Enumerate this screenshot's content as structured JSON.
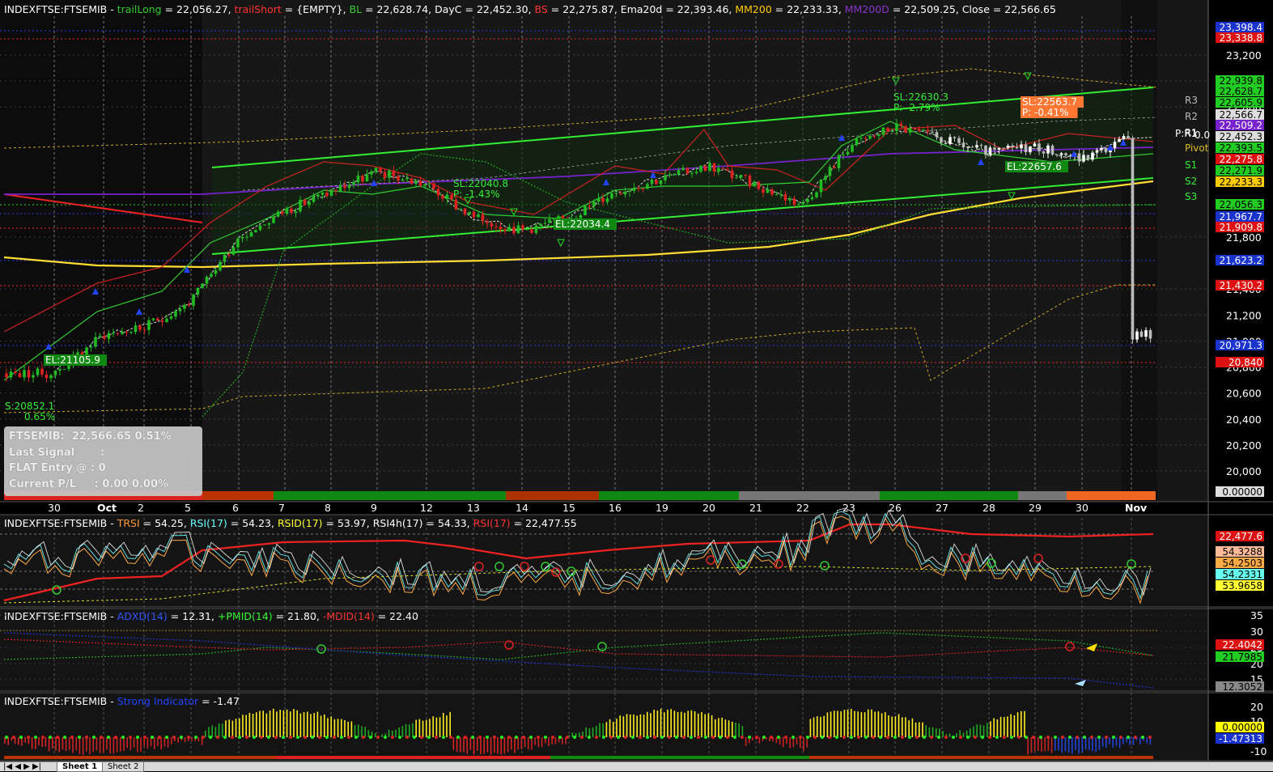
{
  "panels": {
    "price": {
      "header": [
        {
          "t": "INDEXFTSE:FTSEMIB - ",
          "c": "#ffffff"
        },
        {
          "t": "trailLong",
          "c": "#33cc33"
        },
        {
          "t": " = 22,056.27, ",
          "c": "#ffffff"
        },
        {
          "t": "trailShort",
          "c": "#ff3333"
        },
        {
          "t": " = {EMPTY}, ",
          "c": "#ffffff"
        },
        {
          "t": "BL",
          "c": "#33cc33"
        },
        {
          "t": " = 22,628.74, DayC = 22,452.30, ",
          "c": "#ffffff"
        },
        {
          "t": "BS",
          "c": "#ff3333"
        },
        {
          "t": " = 22,275.87, Ema20d = 22,393.46, ",
          "c": "#ffffff"
        },
        {
          "t": "MM200",
          "c": "#ffcc00"
        },
        {
          "t": " = 22,233.33, ",
          "c": "#ffffff"
        },
        {
          "t": "MM200D",
          "c": "#8833cc"
        },
        {
          "t": " = 22,509.25, Close = 22,566.65",
          "c": "#ffffff"
        }
      ],
      "y_ticks": [
        "23,200",
        "23,000",
        "22,800",
        "21,800",
        "21,400",
        "21,200",
        "21,000",
        "20,800",
        "20,600",
        "20,400",
        "20,200",
        "20,000"
      ],
      "badges": [
        {
          "v": "23,398.4",
          "bg": "#1a33cc",
          "fg": "#ffffff"
        },
        {
          "v": "23,338.8",
          "bg": "#dd1111",
          "fg": "#ffffff"
        },
        {
          "v": "22,939.8",
          "bg": "#22cc22",
          "fg": "#000000"
        },
        {
          "v": "22,628.7",
          "bg": "#22cc22",
          "fg": "#000000"
        },
        {
          "v": "22,605.9",
          "bg": "#22cc22",
          "fg": "#000000"
        },
        {
          "v": "22,566.7",
          "bg": "#dddddd",
          "fg": "#000000"
        },
        {
          "v": "22,509.2",
          "bg": "#7722cc",
          "fg": "#ffffff"
        },
        {
          "v": "22,452.3",
          "bg": "#dddddd",
          "fg": "#000000"
        },
        {
          "v": "22,393.5",
          "bg": "#22cc22",
          "fg": "#000000"
        },
        {
          "v": "22,275.8",
          "bg": "#dd1111",
          "fg": "#ffffff"
        },
        {
          "v": "22,271.9",
          "bg": "#22cc22",
          "fg": "#000000"
        },
        {
          "v": "22,233.3",
          "bg": "#ffcc00",
          "fg": "#000000"
        },
        {
          "v": "22,056.3",
          "bg": "#22cc22",
          "fg": "#000000"
        },
        {
          "v": "21,967.7",
          "bg": "#1a33cc",
          "fg": "#ffffff"
        },
        {
          "v": "21,909.8",
          "bg": "#dd1111",
          "fg": "#ffffff"
        },
        {
          "v": "21,623.2",
          "bg": "#1a33cc",
          "fg": "#ffffff"
        },
        {
          "v": "21,430.2",
          "bg": "#dd1111",
          "fg": "#ffffff"
        },
        {
          "v": "20,971.3",
          "bg": "#1a33cc",
          "fg": "#ffffff"
        },
        {
          "v": "20,840",
          "bg": "#dd1111",
          "fg": "#ffffff"
        },
        {
          "v": "0.00000",
          "bg": "#dddddd",
          "fg": "#000000"
        }
      ],
      "pivot_labels": [
        "R3",
        "R2",
        "R1",
        "Pivot",
        "S1",
        "S2",
        "S3"
      ],
      "pivot_extra": "P:R1",
      "pivot_extra2": "0.0",
      "annotations": [
        "EL:21105.9",
        "S:20852.1",
        "0.65%",
        "SL:22040.8",
        "P: -1.43%",
        "EL:22034.4",
        "SL:22630.3",
        "P: -2.79%",
        "SL:22563.7",
        "P: -0.41%",
        "EL:22657.6"
      ],
      "x_labels": [
        "30",
        "Oct",
        "2",
        "5",
        "6",
        "7",
        "8",
        "9",
        "12",
        "13",
        "14",
        "15",
        "16",
        "19",
        "20",
        "21",
        "22",
        "23",
        "26",
        "27",
        "28",
        "29",
        "30",
        "Nov"
      ],
      "info_box": [
        "FTSEMIB:  22,566.65 0.51%",
        "Last Signal       :",
        "FLAT Entry @ : 0",
        "Current P/L     : 0.00 0.00%"
      ]
    },
    "rsi": {
      "header": [
        {
          "t": "INDEXFTSE:FTSEMIB - ",
          "c": "#ffffff"
        },
        {
          "t": "TRSI",
          "c": "#ff9933"
        },
        {
          "t": " = 54.25, ",
          "c": "#ffffff"
        },
        {
          "t": "RSI(17)",
          "c": "#66ffff"
        },
        {
          "t": " = 54.23, ",
          "c": "#ffffff"
        },
        {
          "t": "RSID(17)",
          "c": "#ffff33"
        },
        {
          "t": " = 53.97, ",
          "c": "#ffffff"
        },
        {
          "t": "RSI4h(17)",
          "c": "#ffffff"
        },
        {
          "t": " = 54.33, ",
          "c": "#ffffff"
        },
        {
          "t": "RSI(17)",
          "c": "#ff3333"
        },
        {
          "t": " = 22,477.55",
          "c": "#ffffff"
        }
      ],
      "badges": [
        {
          "v": "22,477.6",
          "bg": "#dd1111",
          "fg": "#ffffff"
        },
        {
          "v": "54.3288",
          "bg": "#ffbb99",
          "fg": "#000000"
        },
        {
          "v": "54.2503",
          "bg": "#ffaa44",
          "fg": "#000000"
        },
        {
          "v": "54.2331",
          "bg": "#66ffee",
          "fg": "#000000"
        },
        {
          "v": "53.9658",
          "bg": "#ffff33",
          "fg": "#000000"
        }
      ]
    },
    "adx": {
      "header": [
        {
          "t": "INDEXFTSE:FTSEMIB - ",
          "c": "#ffffff"
        },
        {
          "t": "ADXD(14)",
          "c": "#3355ff"
        },
        {
          "t": " = 12.31, ",
          "c": "#ffffff"
        },
        {
          "t": "+PMID(14)",
          "c": "#33ff33"
        },
        {
          "t": " = 21.80, ",
          "c": "#ffffff"
        },
        {
          "t": "-MDID(14)",
          "c": "#ff3333"
        },
        {
          "t": " = 22.40",
          "c": "#ffffff"
        }
      ],
      "y_ticks": [
        "35",
        "30",
        "25",
        "20",
        "15"
      ],
      "badges": [
        {
          "v": "22.4042",
          "bg": "#dd1111",
          "fg": "#ffffff"
        },
        {
          "v": "21.7985",
          "bg": "#22cc22",
          "fg": "#000000"
        },
        {
          "v": "12.3052",
          "bg": "#888888",
          "fg": "#000000"
        }
      ]
    },
    "strong": {
      "header": [
        {
          "t": "INDEXFTSE:FTSEMIB - ",
          "c": "#ffffff"
        },
        {
          "t": "Strong Indicator",
          "c": "#2244ff"
        },
        {
          "t": " = -1.47",
          "c": "#ffffff"
        }
      ],
      "y_ticks": [
        "20",
        "10",
        "-10"
      ],
      "badges": [
        {
          "v": "0.00000",
          "bg": "#ffff00",
          "fg": "#000000"
        },
        {
          "v": "-1.47313",
          "bg": "#1a33cc",
          "fg": "#ffffff"
        }
      ]
    }
  },
  "sheetbar": {
    "tab1": "Sheet 1",
    "tab2": "Sheet 2"
  },
  "chart_data": {
    "type": "line",
    "categories": [
      "30",
      "Oct",
      "2",
      "5",
      "6",
      "7",
      "8",
      "9",
      "12",
      "13",
      "14",
      "15",
      "16",
      "19",
      "20",
      "21",
      "22",
      "23",
      "26",
      "27",
      "28",
      "29",
      "30",
      "Nov"
    ],
    "series": [
      {
        "name": "Close",
        "values": [
          20750,
          21050,
          21100,
          21300,
          21800,
          22000,
          22150,
          22300,
          22200,
          21950,
          21850,
          21950,
          22150,
          22250,
          22350,
          22200,
          22050,
          22500,
          22650,
          22550,
          22450,
          22500,
          22400,
          22566.65
        ]
      },
      {
        "name": "MM200",
        "values": [
          21550,
          21500,
          21480,
          21470,
          21470,
          21480,
          21500,
          21520,
          21550,
          21570,
          21600,
          21620,
          21650,
          21680,
          21720,
          21760,
          21820,
          21900,
          22000,
          22080,
          22150,
          22190,
          22220,
          22233.33
        ]
      },
      {
        "name": "MM200D",
        "values": [
          22050,
          22080,
          22100,
          22120,
          22140,
          22160,
          22180,
          22200,
          22220,
          22240,
          22260,
          22270,
          22290,
          22310,
          22330,
          22350,
          22370,
          22400,
          22430,
          22460,
          22480,
          22495,
          22505,
          22509.25
        ]
      }
    ],
    "ylim": [
      20000,
      23300
    ],
    "secondary": {
      "rsi": {
        "TRSI": 54.25,
        "RSI(17)": 54.23,
        "RSID(17)": 53.97,
        "RSI4h(17)": 54.33
      },
      "adx": {
        "ADXD(14)": 12.31,
        "+PMID(14)": 21.8,
        "-MDID(14)": 22.4
      },
      "strong_indicator": -1.47
    }
  }
}
